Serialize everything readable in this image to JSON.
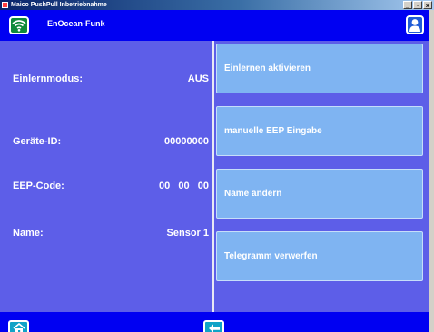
{
  "window": {
    "title": "Maico PushPull Inbetriebnahme",
    "minimize_glyph": "_",
    "maximize_glyph": "▫",
    "close_glyph": "x"
  },
  "header": {
    "title": "EnOcean-Funk",
    "left_icon": "wifi-icon",
    "right_icon": "user-icon"
  },
  "fields": {
    "learn_mode": {
      "label": "Einlernmodus:",
      "value": "AUS"
    },
    "device_id": {
      "label": "Geräte-ID:",
      "value": "00000000"
    },
    "eep_code": {
      "label": "EEP-Code:",
      "value": "00   00   00"
    },
    "name": {
      "label": "Name:",
      "value": "Sensor 1"
    }
  },
  "actions": {
    "teach_in": "Einlernen  aktivieren",
    "manual_eep": "manuelle EEP Eingabe",
    "rename": "Name ändern",
    "discard": "Telegramm verwerfen"
  },
  "footer": {
    "left_icon": "home-icon",
    "center_icon": "back-arrow-icon"
  },
  "colors": {
    "background": "#5d5ee8",
    "bar": "#0000f2",
    "button": "#7fb4f2",
    "wifi_button": "#0f8a3a",
    "nav_button": "#0fa3c7"
  }
}
